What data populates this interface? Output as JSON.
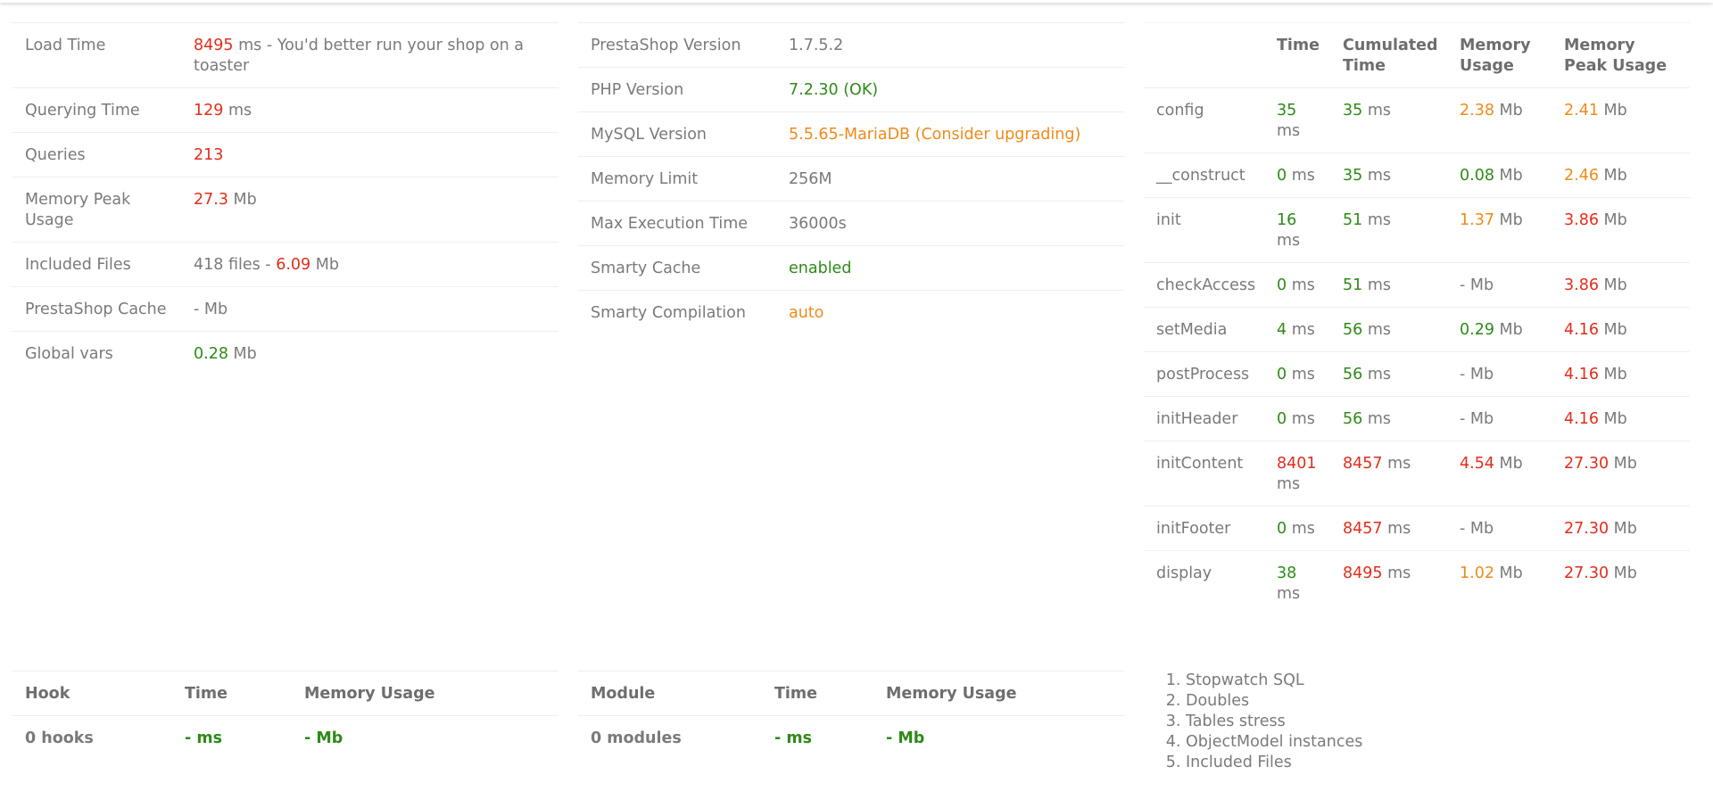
{
  "summary": {
    "rows": [
      {
        "label": "Load Time",
        "value": "8495",
        "value_class": "red",
        "suffix": " ms - You'd better run your shop on a toaster"
      },
      {
        "label": "Querying Time",
        "value": "129",
        "value_class": "red",
        "suffix": " ms"
      },
      {
        "label": "Queries",
        "value": "213",
        "value_class": "red",
        "suffix": ""
      },
      {
        "label": "Memory Peak Usage",
        "value": "27.3",
        "value_class": "red",
        "suffix": " Mb"
      },
      {
        "label": "Included Files",
        "value": "418 files - ",
        "value_class": "plain",
        "extra": "6.09",
        "extra_class": "red",
        "suffix": " Mb"
      },
      {
        "label": "PrestaShop Cache",
        "value": "-",
        "value_class": "plain",
        "suffix": " Mb"
      },
      {
        "label": "Global vars",
        "value": "0.28",
        "value_class": "green",
        "suffix": " Mb"
      }
    ]
  },
  "config": {
    "rows": [
      {
        "label": "PrestaShop Version",
        "value": "1.7.5.2",
        "value_class": "plain"
      },
      {
        "label": "PHP Version",
        "value": "7.2.30 (OK)",
        "value_class": "green"
      },
      {
        "label": "MySQL Version",
        "value": "5.5.65-MariaDB (Consider upgrading)",
        "value_class": "orange"
      },
      {
        "label": "Memory Limit",
        "value": "256M",
        "value_class": "plain"
      },
      {
        "label": "Max Execution Time",
        "value": "36000s",
        "value_class": "plain"
      },
      {
        "label": "Smarty Cache",
        "value": "enabled",
        "value_class": "green"
      },
      {
        "label": "Smarty Compilation",
        "value": "auto",
        "value_class": "orange"
      }
    ]
  },
  "steps": {
    "headers": [
      "",
      "Time",
      "Cumulated Time",
      "Memory Usage",
      "Memory Peak Usage"
    ],
    "rows": [
      {
        "name": "config",
        "time": "35",
        "time_class": "green",
        "cum": "35",
        "cum_class": "green",
        "mem": "2.38",
        "mem_class": "orange",
        "peak": "2.41",
        "peak_class": "orange"
      },
      {
        "name": "__construct",
        "time": "0",
        "time_class": "green",
        "cum": "35",
        "cum_class": "green",
        "mem": "0.08",
        "mem_class": "green",
        "peak": "2.46",
        "peak_class": "orange"
      },
      {
        "name": "init",
        "time": "16",
        "time_class": "green",
        "cum": "51",
        "cum_class": "green",
        "mem": "1.37",
        "mem_class": "orange",
        "peak": "3.86",
        "peak_class": "red"
      },
      {
        "name": "checkAccess",
        "time": "0",
        "time_class": "green",
        "cum": "51",
        "cum_class": "green",
        "mem": "-",
        "mem_class": "plain",
        "peak": "3.86",
        "peak_class": "red"
      },
      {
        "name": "setMedia",
        "time": "4",
        "time_class": "green",
        "cum": "56",
        "cum_class": "green",
        "mem": "0.29",
        "mem_class": "green",
        "peak": "4.16",
        "peak_class": "red"
      },
      {
        "name": "postProcess",
        "time": "0",
        "time_class": "green",
        "cum": "56",
        "cum_class": "green",
        "mem": "-",
        "mem_class": "plain",
        "peak": "4.16",
        "peak_class": "red"
      },
      {
        "name": "initHeader",
        "time": "0",
        "time_class": "green",
        "cum": "56",
        "cum_class": "green",
        "mem": "-",
        "mem_class": "plain",
        "peak": "4.16",
        "peak_class": "red"
      },
      {
        "name": "initContent",
        "time": "8401",
        "time_class": "red",
        "cum": "8457",
        "cum_class": "red",
        "mem": "4.54",
        "mem_class": "red",
        "peak": "27.30",
        "peak_class": "red"
      },
      {
        "name": "initFooter",
        "time": "0",
        "time_class": "green",
        "cum": "8457",
        "cum_class": "red",
        "mem": "-",
        "mem_class": "plain",
        "peak": "27.30",
        "peak_class": "red"
      },
      {
        "name": "display",
        "time": "38",
        "time_class": "green",
        "cum": "8495",
        "cum_class": "red",
        "mem": "1.02",
        "mem_class": "orange",
        "peak": "27.30",
        "peak_class": "red"
      }
    ],
    "time_unit": " ms",
    "mem_unit": " Mb"
  },
  "hooks": {
    "headers": [
      "Hook",
      "Time",
      "Memory Usage"
    ],
    "total": {
      "label": "0 hooks",
      "time": "-",
      "time_unit": " ms",
      "mem": "-",
      "mem_unit": " Mb"
    }
  },
  "modules": {
    "headers": [
      "Module",
      "Time",
      "Memory Usage"
    ],
    "total": {
      "label": "0 modules",
      "time": "-",
      "time_unit": " ms",
      "mem": "-",
      "mem_unit": " Mb"
    }
  },
  "links": [
    "Stopwatch SQL",
    "Doubles",
    "Tables stress",
    "ObjectModel instances",
    "Included Files"
  ],
  "colors": {
    "red": "#e22d1b",
    "green": "#2f8a18",
    "orange": "#ef8a1c",
    "text": "#7a7a7a"
  }
}
